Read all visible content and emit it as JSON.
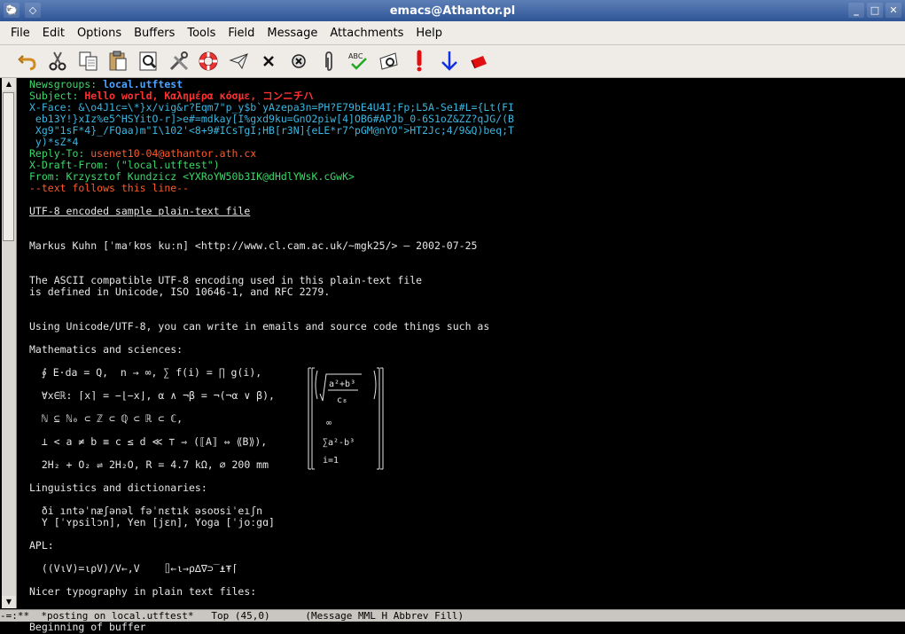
{
  "window": {
    "title": "emacs@Athantor.pl",
    "buttons": [
      "_",
      "□",
      "✕"
    ]
  },
  "menu": [
    "File",
    "Edit",
    "Options",
    "Buffers",
    "Tools",
    "Field",
    "Message",
    "Attachments",
    "Help"
  ],
  "toolbar": {
    "icons": [
      "undo-icon",
      "cut-icon",
      "copy-icon",
      "paste-icon",
      "search-icon",
      "tools-icon",
      "help-lifebuoy-icon",
      "send-icon",
      "delete-x-icon",
      "cancel-icon",
      "attach-icon",
      "spell-check-icon",
      "preview-icon",
      "important-icon",
      "down-arrow-icon",
      "flag-icon"
    ]
  },
  "colors": {
    "header_name": "#3cd96a",
    "newsgroup": "#4aa3ff",
    "subject": "#ff3030",
    "xface": "#3ab6e0",
    "reply_to": "#ff5a28",
    "separator": "#ff5a28"
  },
  "headers": {
    "newsgroups_label": "Newsgroups:",
    "newsgroups_value": "local.utftest",
    "subject_label": "Subject:",
    "subject_value": "Hello world, Καλημέρα κόσμε, コンニチハ",
    "xface_label": "X-Face:",
    "xface_line1": "&\\o4J1c=\\*}x/vig&r?Eqm7\"p_y$b`yAzepa3n=PH?E79bE4U4I;Fp;L5A-Se1#L={Lt(FI",
    "xface_line2": " eb13Y!}xIz%e5^HSYitO-r]>e#=mdkay[I%gxd9ku=GnO2piw[4]OB6#APJb_0-6S1oZ&ZZ?qJG/(B",
    "xface_line3": " Xg9\"1sF*4}_/FQaa)m\"I\\102'<8+9#ICsTgI;HB[r3N]{eLE*r7^pGM@nYO\">HT2Jc;4/9&Q)beq;T",
    "xface_line4": " y)*sZ*4",
    "reply_label": "Reply-To:",
    "reply_value": "usenet10-04@athantor.ath.cx",
    "draft_from": "X-Draft-From: (\"local.utftest\")",
    "from": "From: Krzysztof Kundzicz <YXRoYW50b3IK@dHdlYWsK.cGwK>",
    "separator": "--text follows this line--"
  },
  "body": {
    "title": "UTF-8 encoded sample plain-text file",
    "author": "Markus Kuhn [ˈmaʳkʊs kuːn] <http://www.cl.cam.ac.uk/~mgk25/> — 2002-07-25",
    "intro1": "The ASCII compatible UTF-8 encoding used in this plain-text file",
    "intro2": "is defined in Unicode, ISO 10646-1, and RFC 2279.",
    "using": "Using Unicode/UTF-8, you can write in emails and source code things such as",
    "math_heading": "Mathematics and sciences:",
    "math1": "  ∮ E⋅da = Q,  n → ∞, ∑ f(i) = ∏ g(i),",
    "math2": "  ∀x∈ℝ: ⌈x⌉ = −⌊−x⌋, α ∧ ¬β = ¬(¬α ∨ β),",
    "math3": "  ℕ ⊆ ℕ₀ ⊂ ℤ ⊂ ℚ ⊂ ℝ ⊂ ℂ,",
    "math4": "  ⊥ < a ≠ b ≡ c ≤ d ≪ ⊤ ⇒ (⟦A⟧ ⇔ ⟪B⟫),",
    "math5": "  2H₂ + O₂ ⇌ 2H₂O, R = 4.7 kΩ, ⌀ 200 mm",
    "matrix_top": "a²+b³",
    "matrix_sub": "c₈",
    "matrix_inf": "∞",
    "matrix_sum": "∑a²-b³",
    "matrix_i": "i=1",
    "ling_heading": "Linguistics and dictionaries:",
    "ling1": "  ði ıntəˈnæʃənəl fəˈnɛtık əsoʊsiˈeıʃn",
    "ling2": "  Y [ˈʏpsilɔn], Yen [jɛn], Yoga [ˈjoːgɑ]",
    "apl_heading": "APL:",
    "apl1": "  ((V⍳V)=⍳⍴V)/V←,V    ⌷←⍳→⍴∆∇⊃‾⍎⍕⌈",
    "typo_heading": "Nicer typography in plain text files:"
  },
  "modeline": "-=:**  *posting on local.utftest*   Top (45,0)      (Message MML H Abbrev Fill)",
  "minibuffer": "Beginning of buffer"
}
